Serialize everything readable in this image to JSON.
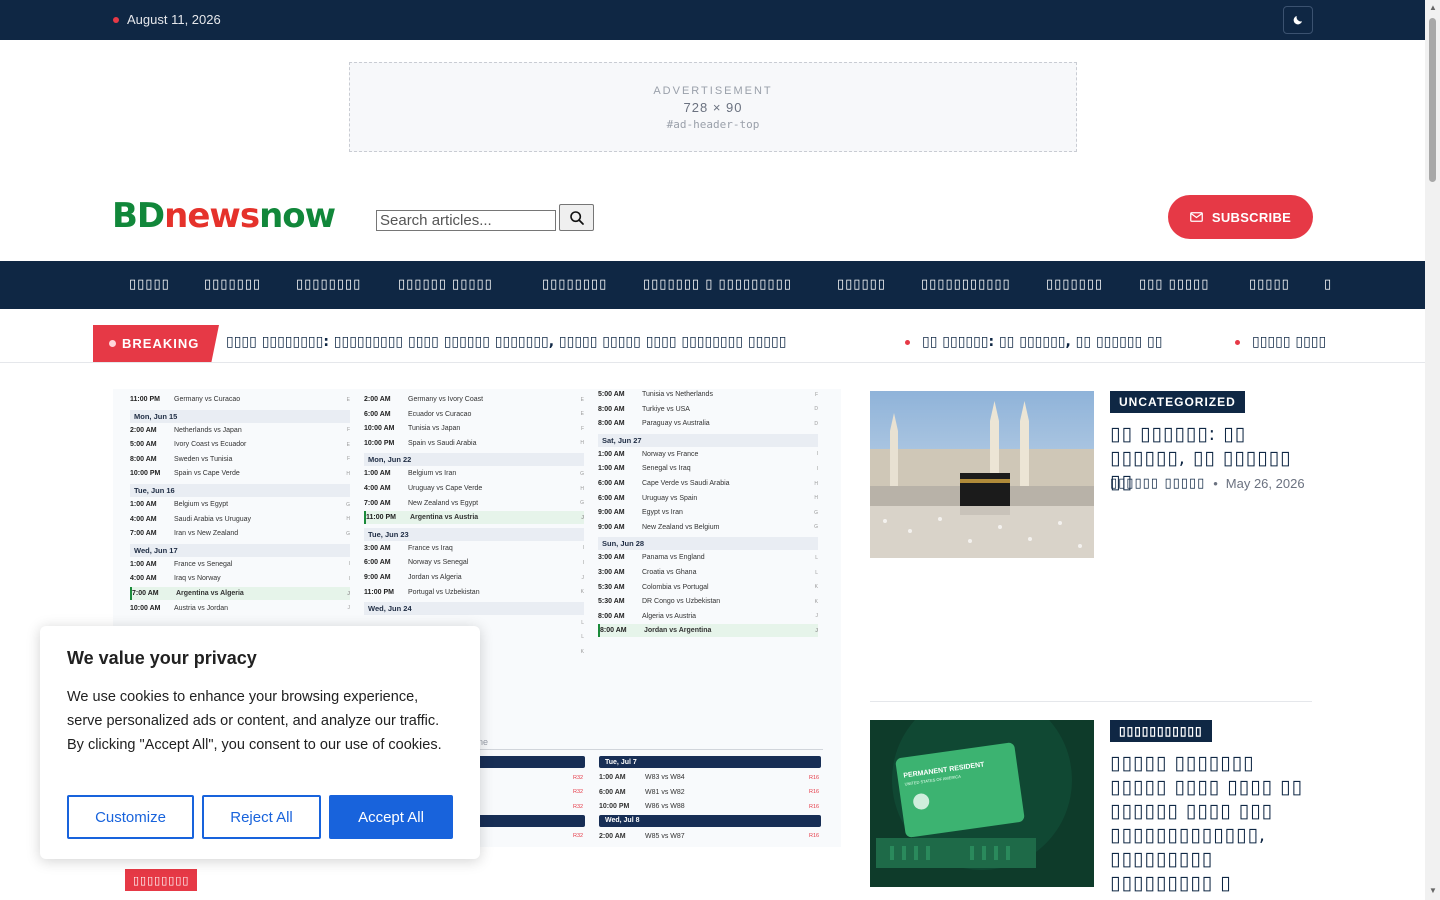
{
  "topbar": {
    "date": "August 11, 2026",
    "dark_toggle_icon": "moon-icon"
  },
  "ad": {
    "label": "ADVERTISEMENT",
    "size": "728 × 90",
    "slot": "#ad-header-top"
  },
  "header": {
    "logo_part1": "BD",
    "logo_part2": "news",
    "logo_part3": "now",
    "search_placeholder": "Search articles...",
    "subscribe_label": "SUBSCRIBE"
  },
  "nav": {
    "items": [
      "▯▯▯▯▯",
      "▯▯▯▯▯▯▯",
      "▯▯▯▯▯▯▯▯",
      "▯▯▯▯▯▯ ▯▯▯▯▯",
      "▯▯▯▯▯▯▯▯",
      "▯▯▯▯▯▯▯ ▯ ▯▯▯▯▯▯▯▯▯",
      "▯▯▯▯▯▯",
      "▯▯▯▯▯▯▯▯▯▯▯",
      "▯▯▯▯▯▯▯",
      "▯▯▯ ▯▯▯▯▯",
      "▯▯▯▯▯",
      "▯"
    ]
  },
  "ticker": {
    "label": "BREAKING",
    "items": [
      "▯▯▯▯ ▯▯▯▯▯▯▯▯: ▯▯▯▯▯▯▯▯▯ ▯▯▯▯ ▯▯▯▯▯▯ ▯▯▯▯▯▯▯, ▯▯▯▯▯ ▯▯▯▯▯ ▯▯▯▯ ▯▯▯▯▯▯▯▯ ▯▯▯▯▯",
      "▯▯ ▯▯▯▯▯▯: ▯▯ ▯▯▯▯▯▯, ▯▯ ▯▯▯▯▯▯ ▯▯",
      "▯▯▯▯▯ ▯▯▯▯"
    ]
  },
  "hero": {
    "category": "▯▯▯▯▯▯▯▯",
    "schedule": {
      "col1": [
        {
          "type": "row",
          "time": "11:00 PM",
          "match": "Germany vs Curacao",
          "grp": "E"
        },
        {
          "type": "day",
          "label": "Mon, Jun 15"
        },
        {
          "type": "row",
          "time": "2:00 AM",
          "match": "Netherlands vs Japan",
          "grp": "F"
        },
        {
          "type": "row",
          "time": "5:00 AM",
          "match": "Ivory Coast vs Ecuador",
          "grp": "E"
        },
        {
          "type": "row",
          "time": "8:00 AM",
          "match": "Sweden vs Tunisia",
          "grp": "F"
        },
        {
          "type": "row",
          "time": "10:00 PM",
          "match": "Spain vs Cape Verde",
          "grp": "H"
        },
        {
          "type": "day",
          "label": "Tue, Jun 16"
        },
        {
          "type": "row",
          "time": "1:00 AM",
          "match": "Belgium vs Egypt",
          "grp": "G"
        },
        {
          "type": "row",
          "time": "4:00 AM",
          "match": "Saudi Arabia vs Uruguay",
          "grp": "H"
        },
        {
          "type": "row",
          "time": "7:00 AM",
          "match": "Iran vs New Zealand",
          "grp": "G"
        },
        {
          "type": "day",
          "label": "Wed, Jun 17"
        },
        {
          "type": "row",
          "time": "1:00 AM",
          "match": "France vs Senegal",
          "grp": "I"
        },
        {
          "type": "row",
          "time": "4:00 AM",
          "match": "Iraq vs Norway",
          "grp": "I"
        },
        {
          "type": "hl",
          "time": "7:00 AM",
          "match": "Argentina vs Algeria",
          "grp": "J"
        },
        {
          "type": "row",
          "time": "10:00 AM",
          "match": "Austria vs Jordan",
          "grp": "J"
        }
      ],
      "col2": [
        {
          "type": "row",
          "time": "2:00 AM",
          "match": "Germany vs Ivory Coast",
          "grp": "E"
        },
        {
          "type": "row",
          "time": "6:00 AM",
          "match": "Ecuador vs Curacao",
          "grp": "E"
        },
        {
          "type": "row",
          "time": "10:00 AM",
          "match": "Tunisia vs Japan",
          "grp": "F"
        },
        {
          "type": "row",
          "time": "10:00 PM",
          "match": "Spain vs Saudi Arabia",
          "grp": "H"
        },
        {
          "type": "day",
          "label": "Mon, Jun 22"
        },
        {
          "type": "row",
          "time": "1:00 AM",
          "match": "Belgium vs Iran",
          "grp": "G"
        },
        {
          "type": "row",
          "time": "4:00 AM",
          "match": "Uruguay vs Cape Verde",
          "grp": "H"
        },
        {
          "type": "row",
          "time": "7:00 AM",
          "match": "New Zealand vs Egypt",
          "grp": "G"
        },
        {
          "type": "hl",
          "time": "11:00 PM",
          "match": "Argentina vs Austria",
          "grp": "J"
        },
        {
          "type": "day",
          "label": "Tue, Jun 23"
        },
        {
          "type": "row",
          "time": "3:00 AM",
          "match": "France vs Iraq",
          "grp": "I"
        },
        {
          "type": "row",
          "time": "6:00 AM",
          "match": "Norway vs Senegal",
          "grp": "I"
        },
        {
          "type": "row",
          "time": "9:00 AM",
          "match": "Jordan vs Algeria",
          "grp": "J"
        },
        {
          "type": "row",
          "time": "11:00 PM",
          "match": "Portugal vs Uzbekistan",
          "grp": "K"
        },
        {
          "type": "day",
          "label": "Wed, Jun 24"
        },
        {
          "type": "row",
          "time": "",
          "match": "",
          "grp": "L"
        },
        {
          "type": "row",
          "time": "",
          "match": "",
          "grp": "L"
        },
        {
          "type": "row",
          "time": "",
          "match": "go",
          "grp": "K"
        }
      ],
      "col3": [
        {
          "type": "row",
          "time": "5:00 AM",
          "match": "Tunisia vs Netherlands",
          "grp": "F"
        },
        {
          "type": "row",
          "time": "8:00 AM",
          "match": "Turkiye vs USA",
          "grp": "D"
        },
        {
          "type": "row",
          "time": "8:00 AM",
          "match": "Paraguay vs Australia",
          "grp": "D"
        },
        {
          "type": "day",
          "label": "Sat, Jun 27"
        },
        {
          "type": "row",
          "time": "1:00 AM",
          "match": "Norway vs France",
          "grp": "I"
        },
        {
          "type": "row",
          "time": "1:00 AM",
          "match": "Senegal vs Iraq",
          "grp": "I"
        },
        {
          "type": "row",
          "time": "6:00 AM",
          "match": "Cape Verde vs Saudi Arabia",
          "grp": "H"
        },
        {
          "type": "row",
          "time": "6:00 AM",
          "match": "Uruguay vs Spain",
          "grp": "H"
        },
        {
          "type": "row",
          "time": "9:00 AM",
          "match": "Egypt vs Iran",
          "grp": "G"
        },
        {
          "type": "row",
          "time": "9:00 AM",
          "match": "New Zealand vs Belgium",
          "grp": "G"
        },
        {
          "type": "day",
          "label": "Sun, Jun 28"
        },
        {
          "type": "row",
          "time": "3:00 AM",
          "match": "Panama vs England",
          "grp": "L"
        },
        {
          "type": "row",
          "time": "3:00 AM",
          "match": "Croatia vs Ghana",
          "grp": "L"
        },
        {
          "type": "row",
          "time": "5:30 AM",
          "match": "Colombia vs Portugal",
          "grp": "K"
        },
        {
          "type": "row",
          "time": "5:30 AM",
          "match": "DR Congo vs Uzbekistan",
          "grp": "K"
        },
        {
          "type": "row",
          "time": "8:00 AM",
          "match": "Algeria vs Austria",
          "grp": "J"
        },
        {
          "type": "hl",
          "time": "8:00 AM",
          "match": "Jordan vs Argentina",
          "grp": "J"
        }
      ],
      "mid_label": "ne",
      "ko_left": [
        {
          "type": "head",
          "label": ""
        },
        {
          "type": "row",
          "time": "",
          "match": "",
          "round": "R32"
        },
        {
          "type": "row",
          "time": "",
          "match": "",
          "round": "R32"
        },
        {
          "type": "row",
          "time": "",
          "match": "",
          "round": "R32"
        },
        {
          "type": "head",
          "label": ""
        },
        {
          "type": "row",
          "time": "",
          "match": "",
          "round": "R32"
        }
      ],
      "ko_right": [
        {
          "type": "head",
          "label": "Tue, Jul 7"
        },
        {
          "type": "row",
          "time": "1:00 AM",
          "match": "W83 vs W84",
          "round": "R16"
        },
        {
          "type": "row",
          "time": "6:00 AM",
          "match": "W81 vs W82",
          "round": "R16"
        },
        {
          "type": "row",
          "time": "10:00 PM",
          "match": "W86 vs W88",
          "round": "R16"
        },
        {
          "type": "head",
          "label": "Wed, Jul 8"
        },
        {
          "type": "row",
          "time": "2:00 AM",
          "match": "W85 vs W87",
          "round": "R16"
        }
      ]
    }
  },
  "cards": [
    {
      "category": "UNCATEGORIZED",
      "title": "▯▯ ▯▯▯▯▯▯: ▯▯ ▯▯▯▯▯▯, ▯▯ ▯▯▯▯▯▯ ▯▯",
      "author": "▯▯▯▯▯▯ ▯▯▯▯▯",
      "date": "May 26, 2026"
    },
    {
      "category": "▯▯▯▯▯▯▯▯▯▯▯",
      "title": "▯▯▯▯▯ ▯▯▯▯▯▯▯ ▯▯▯▯▯ ▯▯▯▯ ▯▯▯▯ ▯▯ ▯▯▯▯▯▯ ▯▯▯▯ ▯▯▯ ▯▯▯▯▯▯▯▯▯▯▯▯▯, ▯▯▯▯▯▯▯▯▯ ▯▯▯▯▯▯▯▯▯ ▯ ▯▯▯▯▯▯▯ ▯▯▯▯▯▯▯",
      "card_art_label": "PERMANENT RESIDENT",
      "card_art_sub": "UNITED STATES OF AMERICA"
    }
  ],
  "cookie": {
    "title": "We value your privacy",
    "text": "We use cookies to enhance your browsing experience, serve personalized ads or content, and analyze our traffic. By clicking \"Accept All\", you consent to our use of cookies.",
    "customize": "Customize",
    "reject": "Reject All",
    "accept": "Accept All"
  },
  "colors": {
    "navy": "#0f2744",
    "accent": "#e63946",
    "cookie_blue": "#1863dc"
  }
}
